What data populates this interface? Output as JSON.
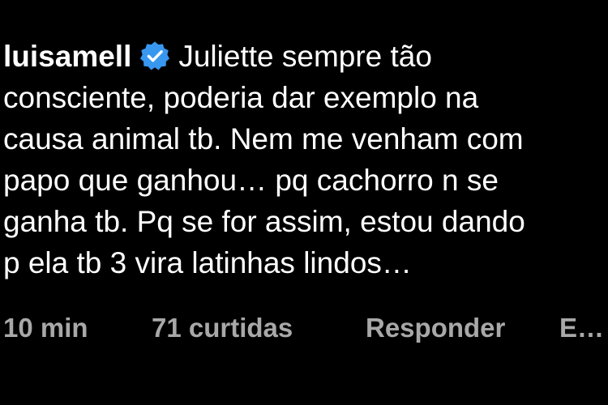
{
  "comment": {
    "username": "luisamell",
    "verified_icon": "verified-badge-icon",
    "verified_color": "#3897f0",
    "lines": [
      "Juliette sempre tão",
      "consciente, poderia dar exemplo na",
      "causa animal tb. Nem me venham com",
      "papo que ganhou… pq cachorro n se",
      "ganha tb. Pq se for assim, estou dando",
      "p ela tb 3 vira latinhas lindos…"
    ]
  },
  "meta": {
    "time": "10 min",
    "likes": "71 curtidas",
    "reply": "Responder",
    "more": "E…"
  }
}
